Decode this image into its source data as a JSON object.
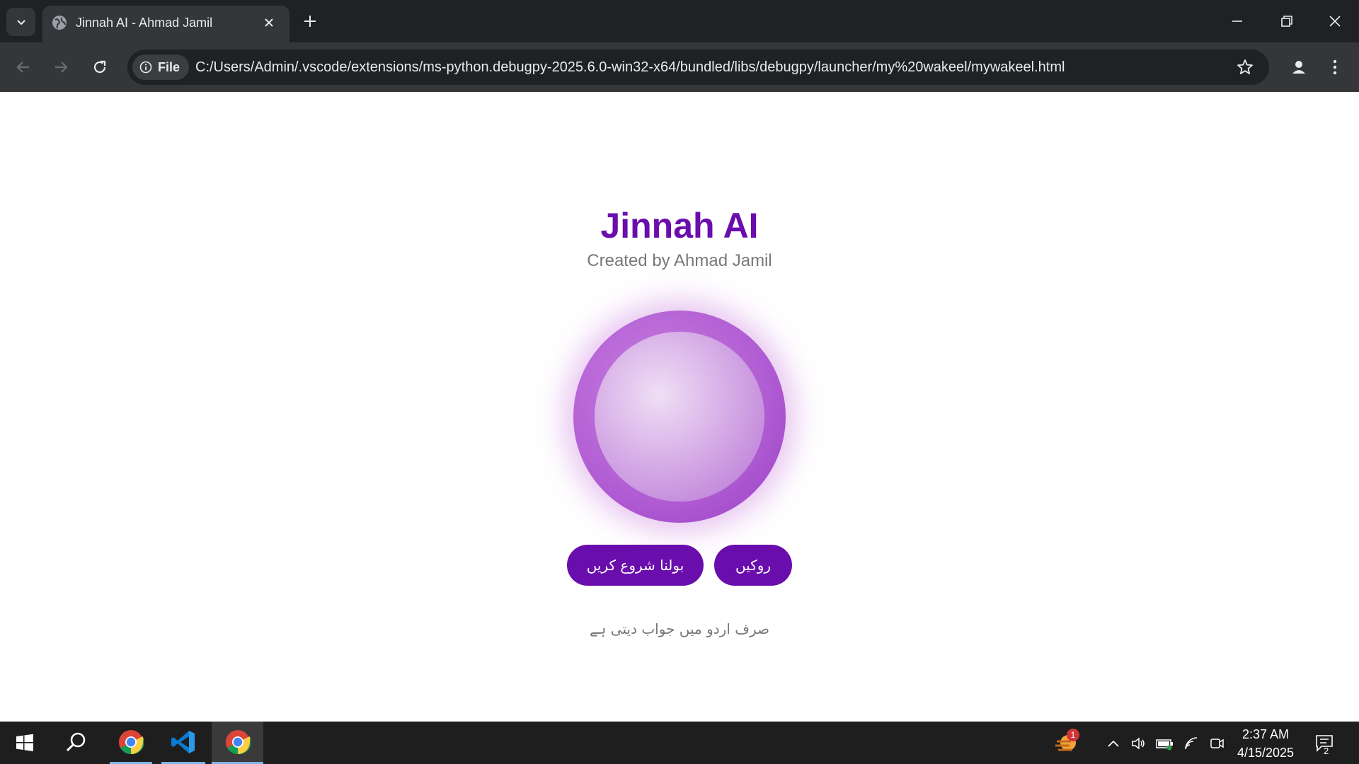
{
  "browser": {
    "tab_title": "Jinnah AI - Ahmad Jamil",
    "chip_label": "File",
    "url": "C:/Users/Admin/.vscode/extensions/ms-python.debugpy-2025.6.0-win32-x64/bundled/libs/debugpy/launcher/my%20wakeel/mywakeel.html"
  },
  "page": {
    "title": "Jinnah AI",
    "subtitle": "Created by Ahmad Jamil",
    "start_button": "بولنا شروع کریں",
    "stop_button": "روکیں",
    "note": "صرف اردو میں جواب دیتی ہے"
  },
  "colors": {
    "accent": "#6a0dad",
    "orb": "#b25fd4"
  },
  "taskbar": {
    "time": "2:37 AM",
    "date": "4/15/2025",
    "weather_badge": "1",
    "notification_count": "2",
    "apps": [
      "start-icon",
      "search-icon",
      "chrome-icon",
      "vscode-icon",
      "chrome-icon"
    ]
  }
}
